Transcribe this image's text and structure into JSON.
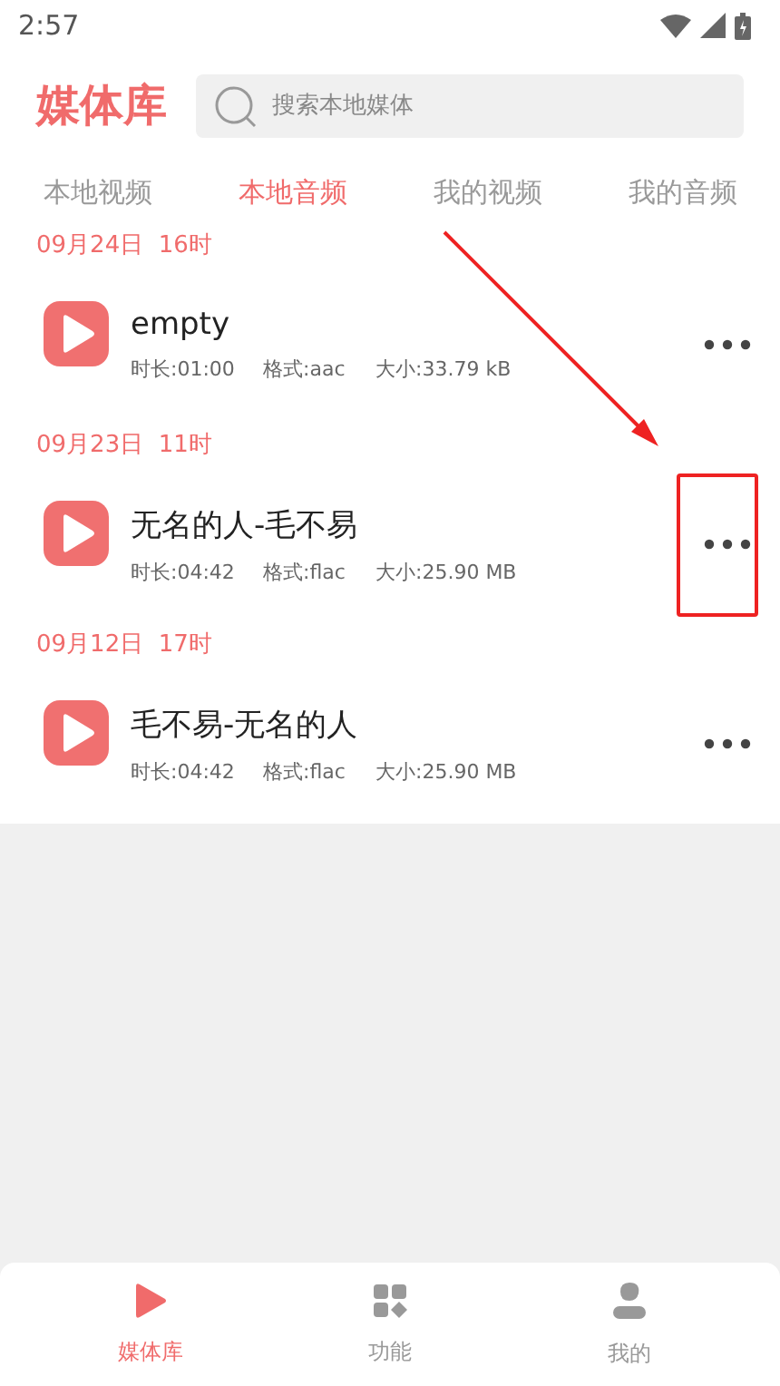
{
  "status_bar": {
    "time": "2:57"
  },
  "header": {
    "title": "媒体库",
    "search": {
      "placeholder": "搜索本地媒体"
    }
  },
  "tabs": [
    {
      "label": "本地视频",
      "selected": false
    },
    {
      "label": "本地音频",
      "selected": true
    },
    {
      "label": "我的视频",
      "selected": false
    },
    {
      "label": "我的音频",
      "selected": false
    }
  ],
  "groups": [
    {
      "date": "09月24日  16时",
      "items": [
        {
          "title": "empty",
          "duration": "时长:01:00",
          "format": "格式:aac",
          "size": "大小:33.79 kB",
          "highlighted": false
        }
      ]
    },
    {
      "date": "09月23日  11时",
      "items": [
        {
          "title": "无名的人-毛不易",
          "duration": "时长:04:42",
          "format": "格式:flac",
          "size": "大小:25.90 MB",
          "highlighted": true
        }
      ]
    },
    {
      "date": "09月12日  17时",
      "items": [
        {
          "title": "毛不易-无名的人",
          "duration": "时长:04:42",
          "format": "格式:flac",
          "size": "大小:25.90 MB",
          "highlighted": false
        }
      ]
    }
  ],
  "bottom_nav": [
    {
      "label": "媒体库",
      "kind": "play",
      "selected": true
    },
    {
      "label": "功能",
      "kind": "grid",
      "selected": false
    },
    {
      "label": "我的",
      "kind": "person",
      "selected": false
    }
  ]
}
